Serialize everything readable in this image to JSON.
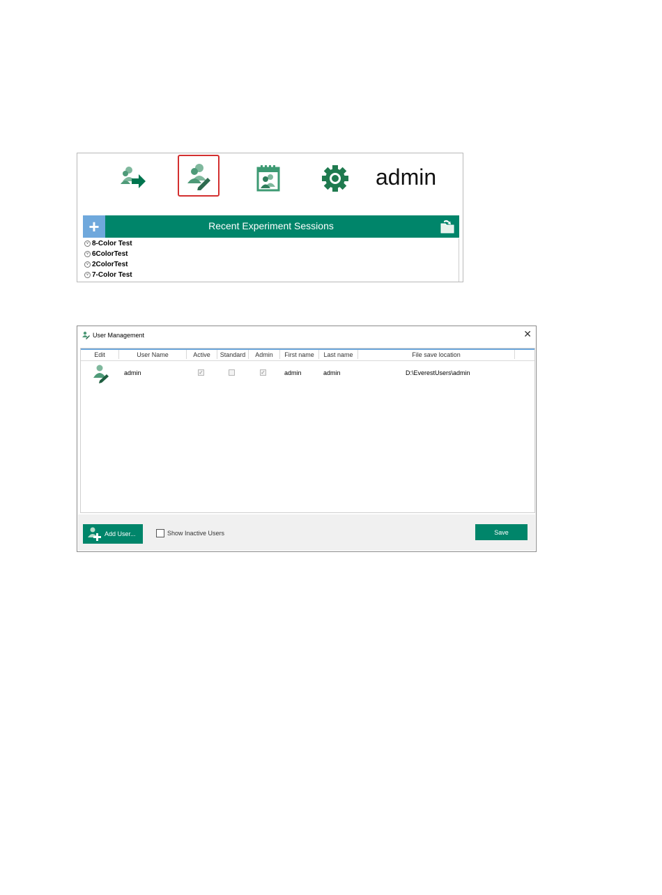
{
  "toolbar": {
    "icons": [
      "user-login-icon",
      "user-edit-icon",
      "calendar-user-icon",
      "gear-icon"
    ],
    "username": "admin",
    "accent_color": "#00856a",
    "selected_border_color": "#d32f2f"
  },
  "sessions": {
    "title": "Recent Experiment Sessions",
    "add_label": "+",
    "items": [
      {
        "label": "8-Color Test"
      },
      {
        "label": "6ColorTest"
      },
      {
        "label": "2ColorTest"
      },
      {
        "label": "7-Color Test"
      }
    ]
  },
  "dialog": {
    "title": "User Management",
    "close_label": "✕",
    "columns": {
      "edit": "Edit",
      "user_name": "User Name",
      "active": "Active",
      "standard": "Standard",
      "admin": "Admin",
      "first_name": "First name",
      "last_name": "Last name",
      "file_save_location": "File save location"
    },
    "rows": [
      {
        "user_name": "admin",
        "active": true,
        "standard": false,
        "admin": true,
        "first_name": "admin",
        "last_name": "admin",
        "file_save_location": "D:\\EverestUsers\\admin"
      }
    ],
    "add_user_label": "Add User...",
    "show_inactive_label": "Show Inactive Users",
    "show_inactive_checked": false,
    "save_label": "Save"
  }
}
